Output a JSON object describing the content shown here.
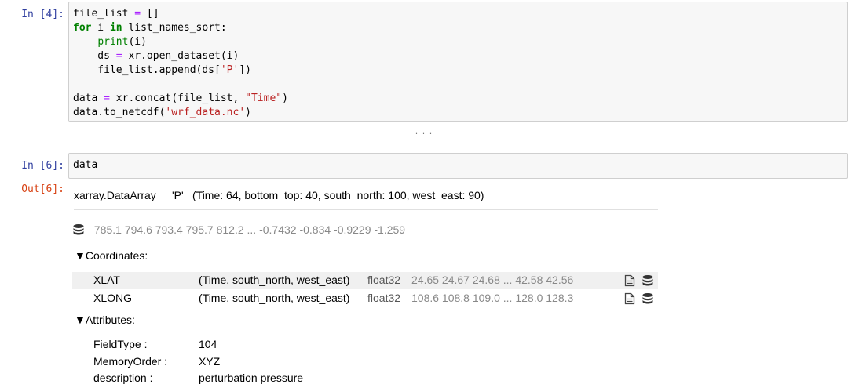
{
  "cells": {
    "cell4": {
      "prompt": "In  [4]:",
      "lines": [
        [
          {
            "t": "file_list "
          },
          {
            "t": "=",
            "c": "op"
          },
          {
            "t": " []"
          }
        ],
        [
          {
            "t": "for",
            "c": "kw"
          },
          {
            "t": " i "
          },
          {
            "t": "in",
            "c": "kw"
          },
          {
            "t": " list_names_sort:"
          }
        ],
        [
          {
            "t": "    "
          },
          {
            "t": "print",
            "c": "bi"
          },
          {
            "t": "(i)"
          }
        ],
        [
          {
            "t": "    ds "
          },
          {
            "t": "=",
            "c": "op"
          },
          {
            "t": " xr.open_dataset(i)"
          }
        ],
        [
          {
            "t": "    file_list.append(ds["
          },
          {
            "t": "'P'",
            "c": "str"
          },
          {
            "t": "])"
          }
        ],
        [
          {
            "t": ""
          }
        ],
        [
          {
            "t": "data "
          },
          {
            "t": "=",
            "c": "op"
          },
          {
            "t": " xr.concat(file_list, "
          },
          {
            "t": "\"Time\"",
            "c": "str"
          },
          {
            "t": ")"
          }
        ],
        [
          {
            "t": "data.to_netcdf("
          },
          {
            "t": "'wrf_data.nc'",
            "c": "str"
          },
          {
            "t": ")"
          }
        ]
      ]
    },
    "collapsed_marker": "· · ·",
    "cell6": {
      "prompt": "In  [6]:",
      "code": "data",
      "out_prompt": "Out[6]:"
    }
  },
  "xarray": {
    "type": "xarray.DataArray",
    "name": "'P'",
    "dims": "(Time: 64, bottom_top: 40, south_north: 100, west_east: 90)",
    "preview": "785.1 794.6 793.4 795.7 812.2 ... -0.7432 -0.834 -0.9229 -1.259",
    "coords_title": "▼Coordinates:",
    "coords": [
      {
        "name": "XLAT",
        "dims": "(Time, south_north, west_east)",
        "dtype": "float32",
        "preview": "24.65 24.67 24.68 ... 42.58 42.56"
      },
      {
        "name": "XLONG",
        "dims": "(Time, south_north, west_east)",
        "dtype": "float32",
        "preview": "108.6 108.8 109.0 ... 128.0 128.3"
      }
    ],
    "attrs_title": "▼Attributes:",
    "attrs": [
      {
        "key": "FieldType :",
        "value": "104"
      },
      {
        "key": "MemoryOrder :",
        "value": "XYZ"
      },
      {
        "key": "description :",
        "value": "perturbation pressure"
      }
    ]
  },
  "icons": {
    "database": "database-icon",
    "file": "file-text-icon"
  },
  "colors": {
    "in_prompt": "#303f9f",
    "out_prompt": "#d84315",
    "keyword": "#008000",
    "string": "#ba2121"
  }
}
